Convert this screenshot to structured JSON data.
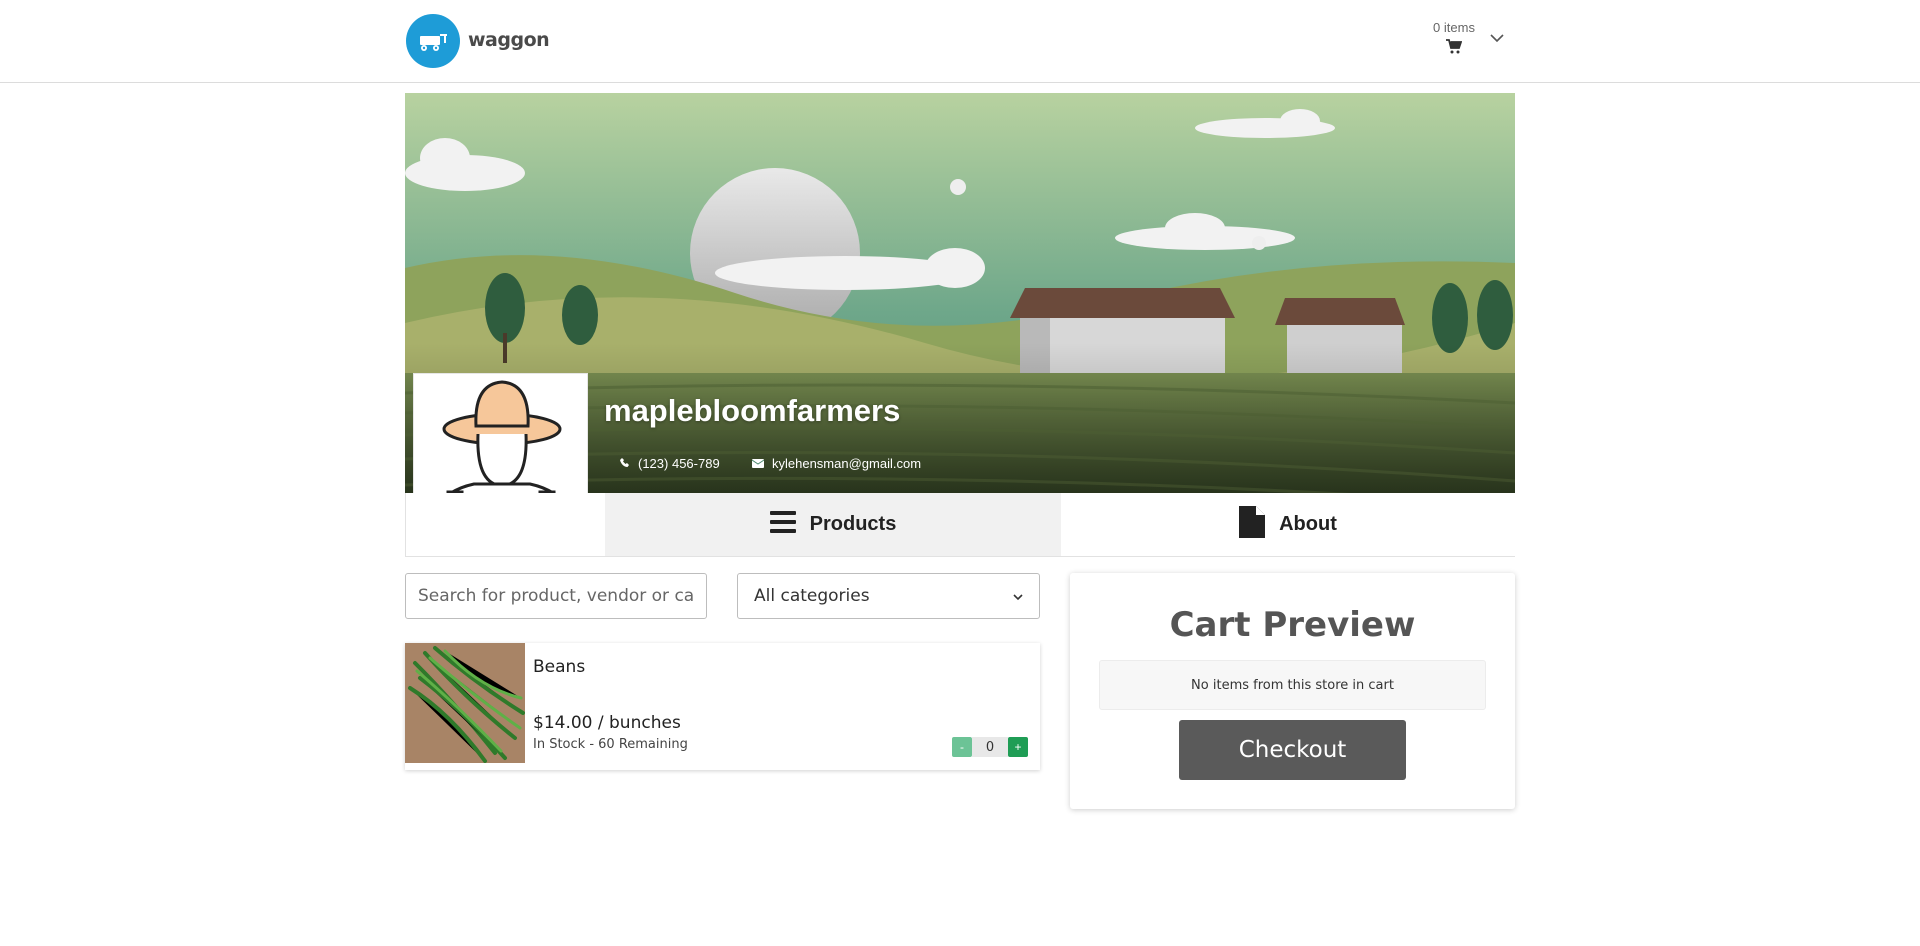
{
  "header": {
    "logo_text": "waggon",
    "cart_count": "0 items"
  },
  "store": {
    "name": "maplebloomfarmers",
    "phone": "(123) 456-789",
    "email": "kylehensman@gmail.com"
  },
  "tabs": [
    {
      "label": "Products",
      "icon": "menu-icon",
      "active": true
    },
    {
      "label": "About",
      "icon": "document-icon",
      "active": false
    }
  ],
  "filters": {
    "search_placeholder": "Search for product, vendor or category",
    "category_selected": "All categories"
  },
  "products": [
    {
      "name": "Beans",
      "price": "$14.00 / bunches",
      "stock": "In Stock - 60 Remaining",
      "quantity": "0",
      "minus_label": "-",
      "plus_label": "+"
    }
  ],
  "cart_preview": {
    "title": "Cart Preview",
    "empty_message": "No items from this store in cart",
    "checkout_label": "Checkout"
  },
  "colors": {
    "brand": "#1e9cd7",
    "checkout": "#5a5a5a",
    "plus": "#1f9d55",
    "minus": "#6cc396"
  }
}
